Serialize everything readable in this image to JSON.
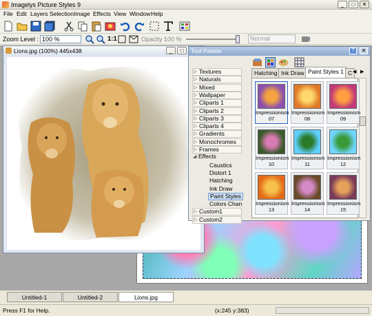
{
  "app": {
    "title": "Imagelys Picture Styles 9"
  },
  "menu": [
    "File",
    "Edit",
    "Layers",
    "Selection",
    "Image",
    "Effects",
    "View",
    "Window",
    "Help"
  ],
  "zoom": {
    "label": "Zoom Level :",
    "value": "100 %",
    "one_to_one": "1:1",
    "opacity_label": "Opacity :",
    "opacity_value": "100 %",
    "blend_mode": "Normal"
  },
  "document": {
    "title": "Lions.jpg (100%) 445x438"
  },
  "palette": {
    "title": "Tool Palette",
    "categories": [
      "Textures",
      "Naturals",
      "Mixed",
      "Wallpaper",
      "Cliparts 1",
      "Cliparts 2",
      "Cliparts 3",
      "Cliparts 4",
      "Gradients",
      "Monochromes",
      "Frames"
    ],
    "effects_label": "Effects",
    "effects_children": [
      "Caustics",
      "Distort 1",
      "Hatching",
      "Ink Draw",
      "Paint Styles",
      "Colors Chan"
    ],
    "after": [
      "Custom1",
      "Custom2"
    ],
    "tabs": [
      "Hatching",
      "Ink Draw",
      "Paint Styles 1"
    ],
    "tab_more": "C",
    "tiles": [
      {
        "name": "Impressionism",
        "num": "07"
      },
      {
        "name": "Impressionism",
        "num": "08"
      },
      {
        "name": "Impressionism",
        "num": "09"
      },
      {
        "name": "Impressionism",
        "num": "10"
      },
      {
        "name": "Impressionism",
        "num": "11"
      },
      {
        "name": "Impressionism",
        "num": "12"
      },
      {
        "name": "Impressionism",
        "num": "13"
      },
      {
        "name": "Impressionism",
        "num": "14"
      },
      {
        "name": "Impressionism",
        "num": "15"
      }
    ]
  },
  "doc_tabs": [
    "Untitled-1",
    "Untitled-2",
    "Lions.jpg"
  ],
  "status": {
    "help": "Press F1 for Help.",
    "coords": "(x:245 y:383)"
  }
}
